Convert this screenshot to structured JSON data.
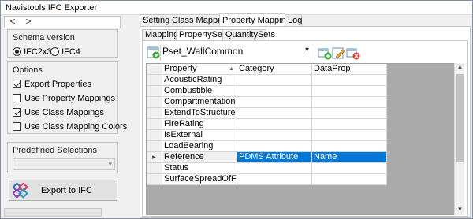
{
  "window": {
    "title": "Navistools IFC Exporter"
  },
  "nav": {
    "back_glyph": "<",
    "forward_glyph": ">"
  },
  "schema": {
    "label": "Schema version",
    "options": [
      {
        "label": "IFC2x3",
        "selected": true
      },
      {
        "label": "IFC4",
        "selected": false
      }
    ]
  },
  "options": {
    "label": "Options",
    "items": [
      {
        "label": "Export Properties",
        "checked": true
      },
      {
        "label": "Use Property Mappings",
        "checked": false
      },
      {
        "label": "Use Class Mappings",
        "checked": true
      },
      {
        "label": "Use Class Mapping Colors",
        "checked": false
      }
    ]
  },
  "predefined": {
    "label": "Predefined Selections",
    "value": ""
  },
  "export": {
    "label": "Export to IFC"
  },
  "tabs": [
    {
      "label": "Settings",
      "active": false
    },
    {
      "label": "Class Mappings",
      "active": false
    },
    {
      "label": "Property Mappings",
      "active": true
    },
    {
      "label": "Log",
      "active": false
    }
  ],
  "subtabs": [
    {
      "label": "Mappings",
      "active": false
    },
    {
      "label": "PropertySets",
      "active": true
    },
    {
      "label": "QuantitySets",
      "active": false
    }
  ],
  "pset": {
    "selected": "Pset_WallCommon"
  },
  "grid": {
    "columns": [
      "Property",
      "Category",
      "DataProp"
    ],
    "sort_indicator": "▲",
    "rows": [
      {
        "property": "AcousticRating",
        "category": "",
        "dataprop": "",
        "selected": false
      },
      {
        "property": "Combustible",
        "category": "",
        "dataprop": "",
        "selected": false
      },
      {
        "property": "Compartmentation",
        "category": "",
        "dataprop": "",
        "selected": false
      },
      {
        "property": "ExtendToStructure",
        "category": "",
        "dataprop": "",
        "selected": false
      },
      {
        "property": "FireRating",
        "category": "",
        "dataprop": "",
        "selected": false
      },
      {
        "property": "IsExternal",
        "category": "",
        "dataprop": "",
        "selected": false
      },
      {
        "property": "LoadBearing",
        "category": "",
        "dataprop": "",
        "selected": false
      },
      {
        "property": "Reference",
        "category": "PDMS Attribute",
        "dataprop": "Name",
        "selected": true
      },
      {
        "property": "Status",
        "category": "",
        "dataprop": "",
        "selected": false
      },
      {
        "property": "SurfaceSpreadOfFlame",
        "category": "",
        "dataprop": "",
        "selected": false
      }
    ]
  },
  "colors": {
    "selection": "#0078d7",
    "add_icon": "#3fa63f",
    "delete_icon": "#d9362b",
    "edit_icon": "#e7a33a"
  },
  "icons": {
    "refresh": "refresh-icon",
    "add": "add-pset-icon",
    "edit": "edit-pset-icon",
    "delete": "delete-pset-icon",
    "logo": "ifc-logo-icon",
    "row_pointer": "▸"
  }
}
